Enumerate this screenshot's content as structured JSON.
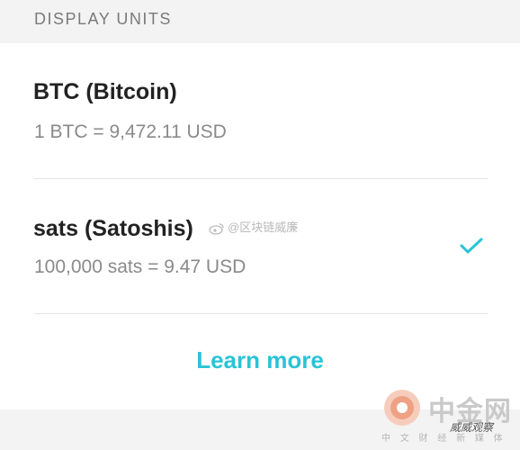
{
  "section": {
    "header": "DISPLAY UNITS"
  },
  "options": [
    {
      "title": "BTC (Bitcoin)",
      "subtitle": "1 BTC = 9,472.11 USD",
      "selected": false
    },
    {
      "title": "sats (Satoshis)",
      "subtitle": "100,000 sats = 9.47 USD",
      "selected": true
    }
  ],
  "learn_more": "Learn more",
  "colors": {
    "accent": "#2bc3d6",
    "title": "#222222",
    "subtitle": "#8a8a8a",
    "header_bg": "#f3f3f3"
  },
  "icons": {
    "selected": "checkmark-icon",
    "weibo": "weibo-icon",
    "watermark": "site-logo-icon"
  },
  "watermarks": {
    "weibo": "@区块链威廉",
    "site": "中金网",
    "site_sub": "中 文 财 经 新 媒 体",
    "handle": "威威观察"
  }
}
